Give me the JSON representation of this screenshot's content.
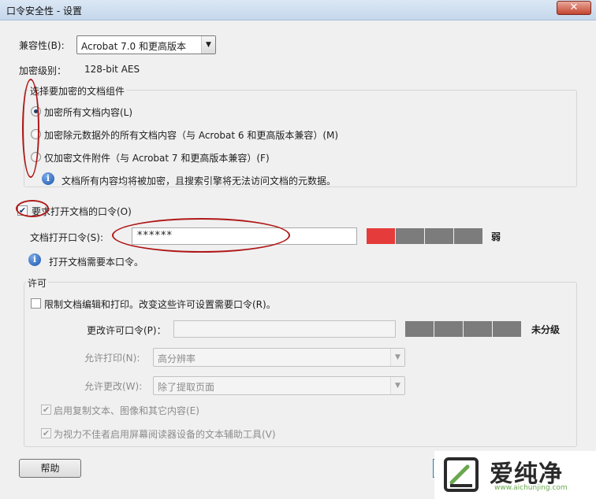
{
  "window": {
    "title": "口令安全性 - 设置",
    "close_glyph": "✕"
  },
  "compatibility": {
    "label": "兼容性(B):",
    "value": "Acrobat 7.0 和更高版本"
  },
  "encryption_level": {
    "label": "加密级别：",
    "value": "128-bit AES"
  },
  "components_group": {
    "title": "选择要加密的文档组件",
    "options": [
      {
        "label": "加密所有文档内容(L)",
        "checked": true
      },
      {
        "label": "加密除元数据外的所有文档内容（与 Acrobat 6 和更高版本兼容）(M)",
        "checked": false
      },
      {
        "label": "仅加密文件附件（与 Acrobat 7 和更高版本兼容）(F)",
        "checked": false
      }
    ],
    "info": "文档所有内容均将被加密，且搜索引擎将无法访问文档的元数据。"
  },
  "open_password": {
    "checkbox_label": "要求打开文档的口令(O)",
    "checked": true,
    "field_label": "文档打开口令(S):",
    "field_value": "******",
    "strength_label": "弱",
    "strength_filled_segments": 1,
    "strength_total_segments": 4,
    "info": "打开文档需要本口令。"
  },
  "permissions": {
    "title": "许可",
    "restrict_label": "限制文档编辑和打印。改变这些许可设置需要口令(R)。",
    "restrict_checked": false,
    "change_password_label": "更改许可口令(P)：",
    "change_password_value": "",
    "strength_label": "未分级",
    "strength_total_segments": 4,
    "printing_label": "允许打印(N):",
    "printing_value": "高分辨率",
    "changes_label": "允许更改(W):",
    "changes_value": "除了提取页面",
    "enable_copy_label": "启用复制文本、图像和其它内容(E)",
    "enable_copy_checked": true,
    "enable_access_label": "为视力不佳者启用屏幕阅读器设备的文本辅助工具(V)",
    "enable_access_checked": true
  },
  "footer": {
    "help_label": "帮助"
  },
  "watermark": {
    "brand": "爱纯净",
    "url": "www.aichunjing.com"
  },
  "colors": {
    "annotation": "#b01818",
    "meter_weak": "#e53b3b",
    "meter_empty": "#7c7c7c"
  }
}
